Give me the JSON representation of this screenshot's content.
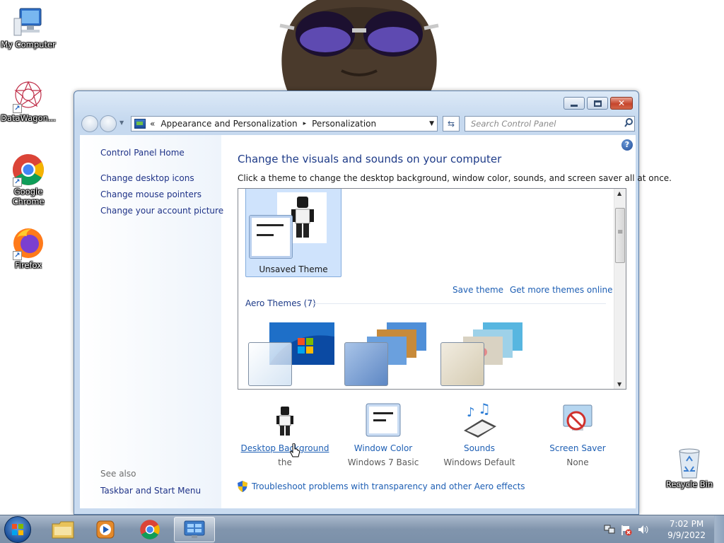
{
  "desktop": {
    "icons": [
      {
        "label": "My Computer",
        "icon": "computer-icon"
      },
      {
        "label": "DataWagon...",
        "icon": "datawagon-icon"
      },
      {
        "label": "Google Chrome",
        "icon": "chrome-icon"
      },
      {
        "label": "Firefox",
        "icon": "firefox-icon"
      },
      {
        "label": "Recycle Bin",
        "icon": "recycle-bin-icon"
      }
    ]
  },
  "window": {
    "address": {
      "chevrons": "«",
      "crumbs": [
        "Appearance and Personalization",
        "Personalization"
      ],
      "separator": "▸",
      "dropdown": "▼"
    },
    "search": {
      "placeholder": "Search Control Panel"
    },
    "caption": {
      "close_glyph": "✕"
    }
  },
  "sidebar": {
    "home": "Control Panel Home",
    "links": [
      "Change desktop icons",
      "Change mouse pointers",
      "Change your account picture"
    ],
    "see_also_label": "See also",
    "see_also_links": [
      "Taskbar and Start Menu"
    ]
  },
  "main": {
    "help": "?",
    "title": "Change the visuals and sounds on your computer",
    "subtitle": "Click a theme to change the desktop background, window color, sounds, and screen saver all at once.",
    "selected_theme": "Unsaved Theme",
    "save_theme": "Save theme",
    "get_more_themes": "Get more themes online",
    "aero_group": "Aero Themes (7)",
    "options": [
      {
        "link": "Desktop Background",
        "value": "the"
      },
      {
        "link": "Window Color",
        "value": "Windows 7 Basic"
      },
      {
        "link": "Sounds",
        "value": "Windows Default"
      },
      {
        "link": "Screen Saver",
        "value": "None"
      }
    ],
    "troubleshoot": "Troubleshoot problems with transparency and other Aero effects"
  },
  "taskbar": {
    "items": [
      "windows-explorer",
      "media-player",
      "chrome",
      "control-panel"
    ],
    "active_item": "control-panel",
    "clock_time": "7:02 PM",
    "clock_date": "9/9/2022"
  },
  "colors": {
    "link": "#1e5fb4",
    "title": "#1e3b88",
    "selected_theme_bg": "#cfe3fc",
    "taskbar": "#8195ad"
  }
}
